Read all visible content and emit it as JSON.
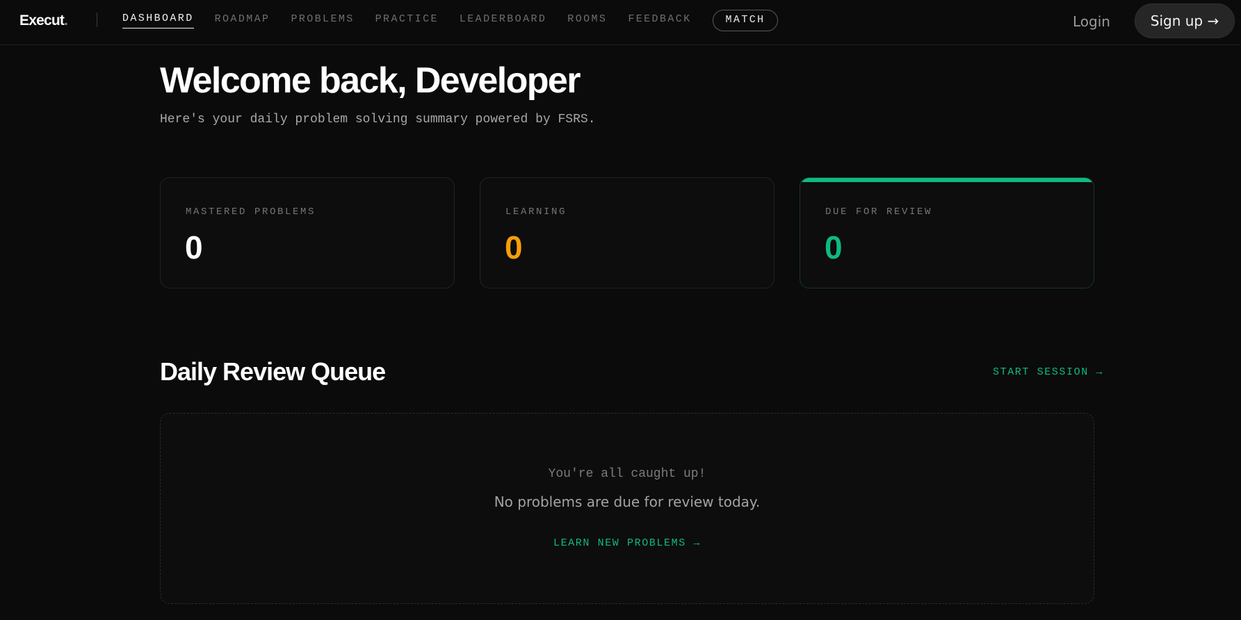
{
  "header": {
    "logo": "Execut",
    "logo_dot": ".",
    "nav": [
      {
        "label": "DASHBOARD",
        "active": true
      },
      {
        "label": "ROADMAP",
        "active": false
      },
      {
        "label": "PROBLEMS",
        "active": false
      },
      {
        "label": "PRACTICE",
        "active": false
      },
      {
        "label": "LEADERBOARD",
        "active": false
      },
      {
        "label": "ROOMS",
        "active": false
      },
      {
        "label": "FEEDBACK",
        "active": false
      }
    ],
    "match_label": "MATCH",
    "login_label": "Login",
    "signup_label": "Sign up →"
  },
  "welcome": {
    "title": "Welcome back, Developer",
    "subtitle": "Here's your daily problem solving summary powered by FSRS."
  },
  "stats": [
    {
      "label": "MASTERED PROBLEMS",
      "value": "0",
      "color": "#ffffff"
    },
    {
      "label": "LEARNING",
      "value": "0",
      "color": "#f59e0b"
    },
    {
      "label": "DUE FOR REVIEW",
      "value": "0",
      "color": "#10b981"
    }
  ],
  "queue": {
    "title": "Daily Review Queue",
    "start_session": "START SESSION →",
    "empty_title": "You're all caught up!",
    "empty_message": "No problems are due for review today.",
    "learn_new": "LEARN NEW PROBLEMS →"
  },
  "colors": {
    "background": "#0b0b0b",
    "accent_green": "#10b981",
    "accent_orange": "#f59e0b"
  }
}
